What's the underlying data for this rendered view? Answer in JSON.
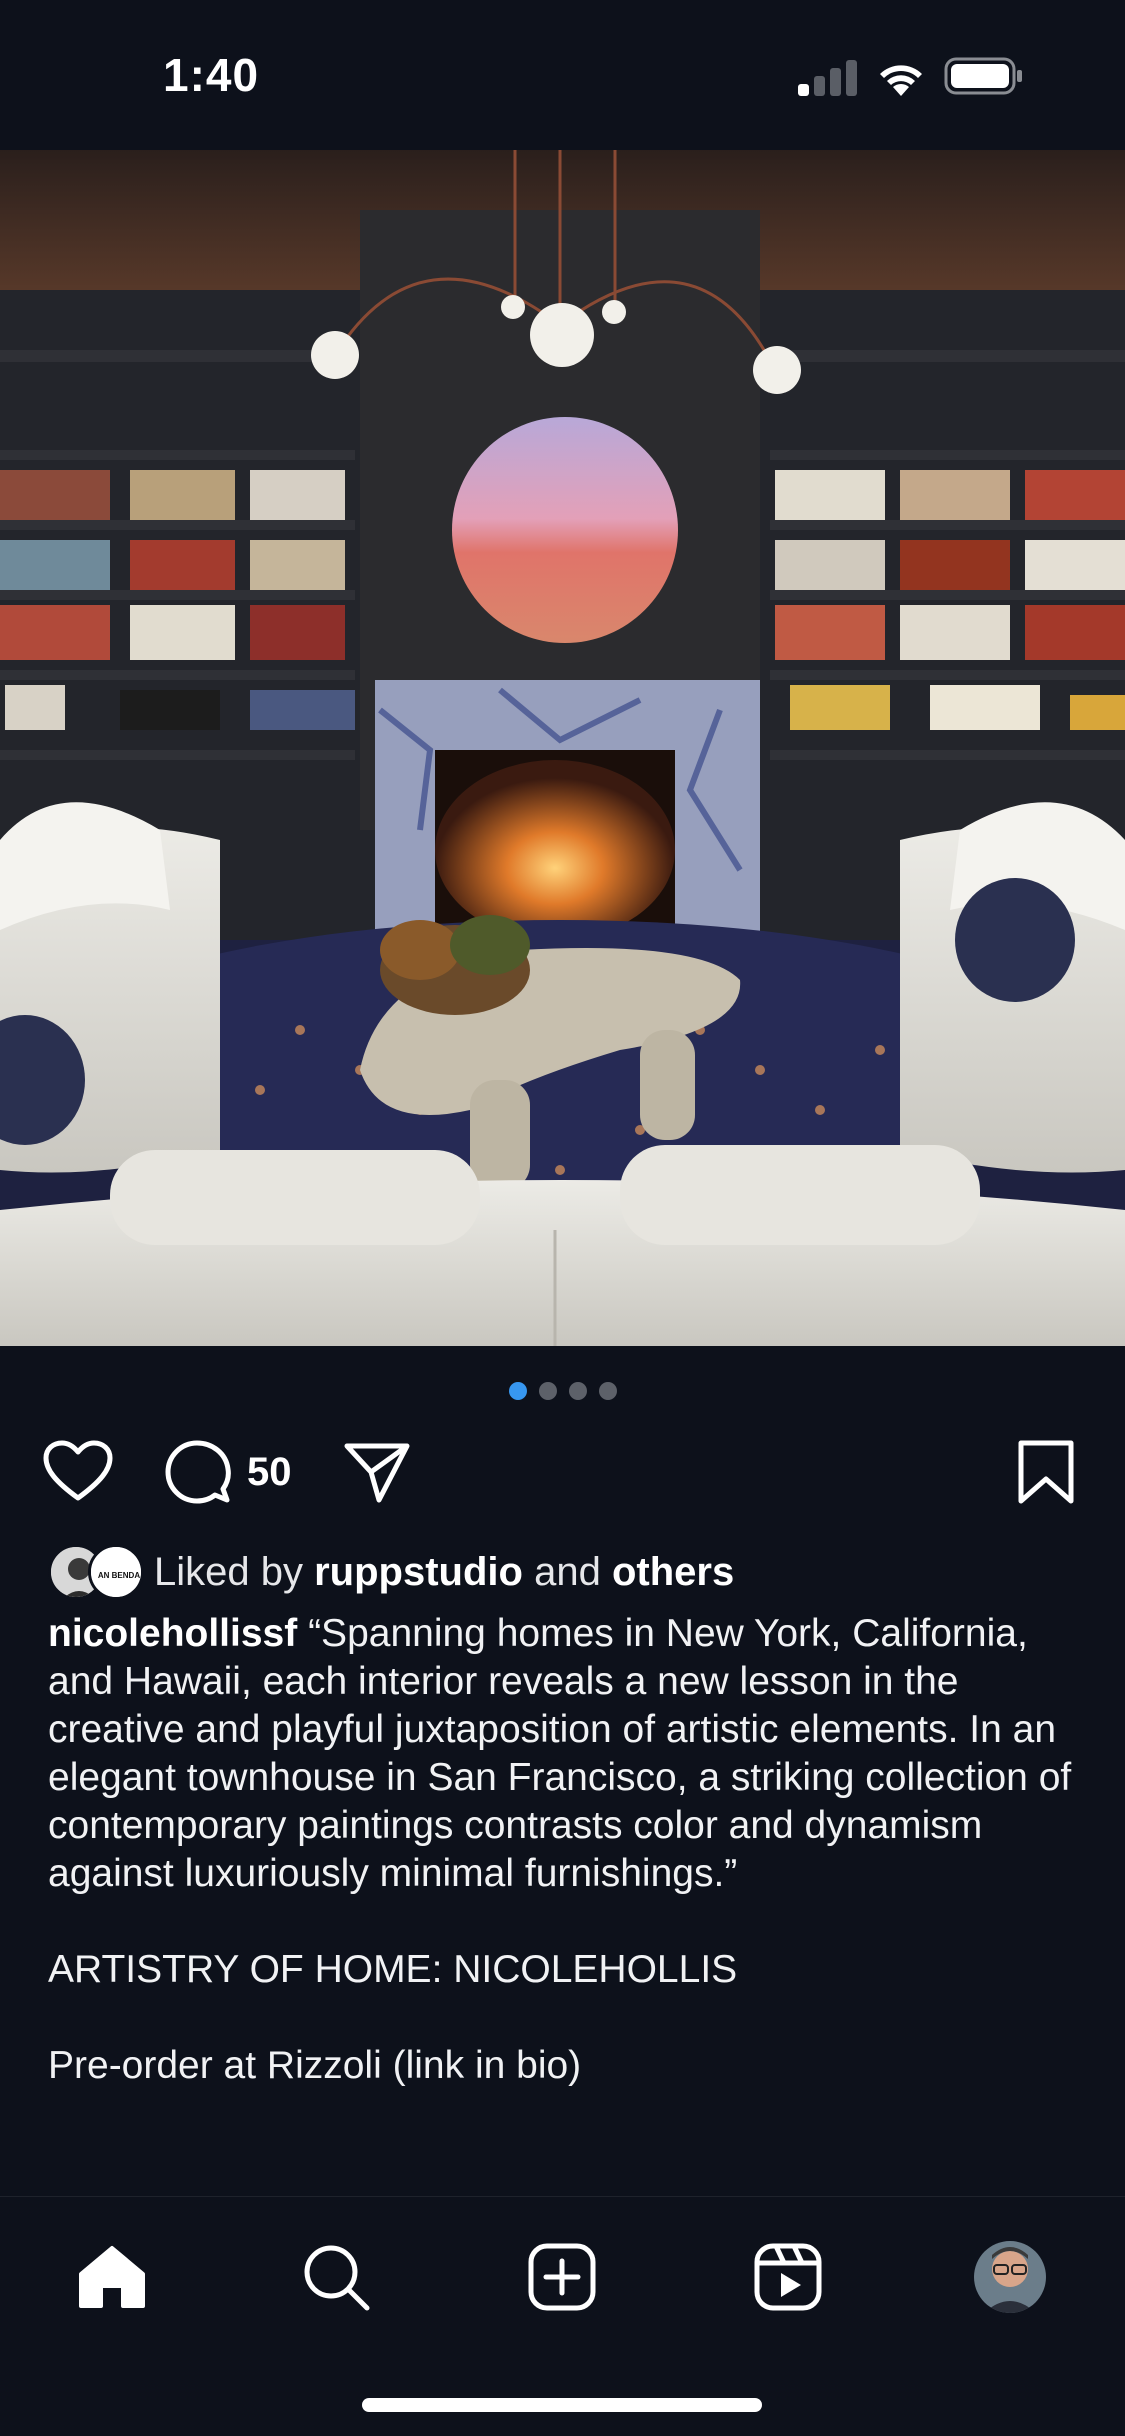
{
  "status_bar": {
    "time": "1:40",
    "signal_icon": "cellular-signal-icon",
    "wifi_icon": "wifi-icon",
    "battery_icon": "battery-icon"
  },
  "post": {
    "image_description_icon": "photo",
    "carousel": {
      "total": 4,
      "active_index": 0
    },
    "actions": {
      "like_icon": "heart-icon",
      "comment_icon": "comment-icon",
      "comment_count": "50",
      "share_icon": "paper-plane-icon",
      "save_icon": "bookmark-icon"
    },
    "likes": {
      "prefix": "Liked by",
      "user": "ruppstudio",
      "conjunction": "and",
      "others": "others",
      "avatar_badge_text": "AN BENDA"
    },
    "caption": {
      "username": "nicolehollissf",
      "text": "“Spanning homes in New York, California, and Hawaii, each interior reveals a new lesson in the creative and playful juxtaposition of artistic elements. In an elegant townhouse in San Francisco, a striking collection of contemporary paintings contrasts color and dynamism against luxuriously minimal furnishings.”",
      "line2": "ARTISTRY OF HOME: NICOLEHOLLIS",
      "line3": "Pre-order at Rizzoli (link in bio)"
    }
  },
  "tab_bar": {
    "items": [
      {
        "name": "home",
        "icon": "home-icon",
        "active": true
      },
      {
        "name": "search",
        "icon": "search-icon"
      },
      {
        "name": "create",
        "icon": "plus-square-icon"
      },
      {
        "name": "reels",
        "icon": "reels-icon"
      },
      {
        "name": "profile",
        "icon": "profile-avatar"
      }
    ]
  },
  "colors": {
    "background": "#0d111b",
    "active_dot": "#3797f0",
    "inactive_dot": "#5d6169"
  }
}
